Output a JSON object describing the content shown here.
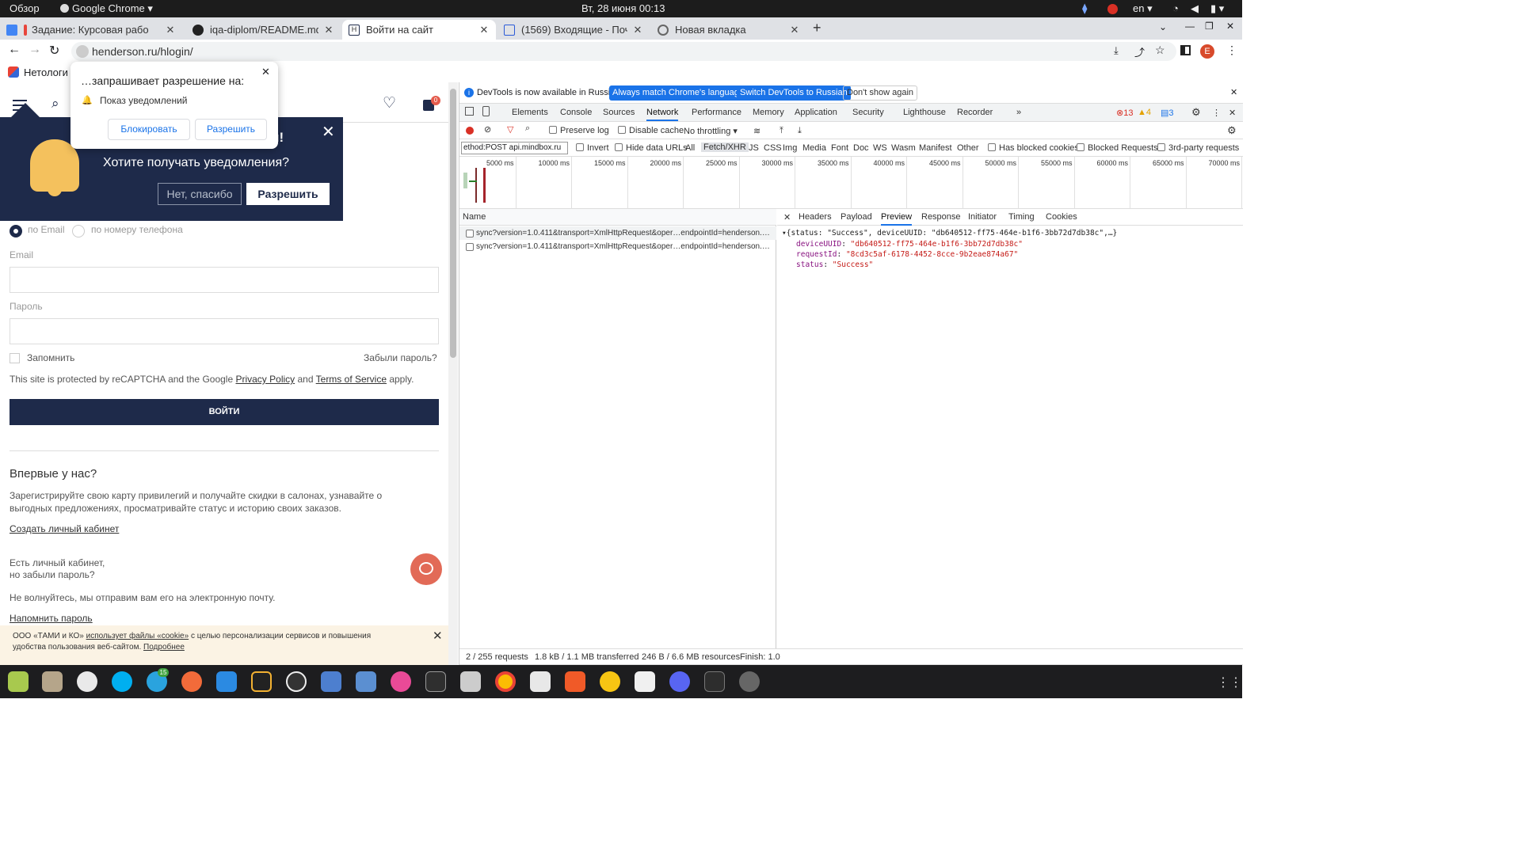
{
  "topbar": {
    "overview": "Обзор",
    "app": "Google Chrome",
    "clock": "Вт, 28 июня  00:13",
    "lang": "en",
    "notif_count": "15"
  },
  "tabs": [
    {
      "title": "Задание: Курсовая рабо"
    },
    {
      "title": "iqa-diplom/README.md"
    },
    {
      "title": "Войти на сайт"
    },
    {
      "title": "(1569) Входящие - Почта"
    },
    {
      "title": "Новая вкладка"
    }
  ],
  "omnibox": {
    "url": "henderson.ru/hlogin/"
  },
  "profile_initial": "E",
  "bookmark": {
    "label": "Нетологи"
  },
  "perm_popup": {
    "title": "…запрашивает разрешение на:",
    "item": "Показ уведомлений",
    "block": "Блокировать",
    "allow": "Разрешить"
  },
  "notif_banner": {
    "title_tail": "и!",
    "question": "Хотите получать уведомления?",
    "no": "Нет, спасибо",
    "yes": "Разрешить"
  },
  "cart_count": "0",
  "login": {
    "radio_email": "по Email",
    "radio_phone": "по номеру телефона",
    "email_label": "Email",
    "password_label": "Пароль",
    "remember": "Запомнить",
    "forgot": "Забыли пароль?",
    "captcha_1": "This site is protected by reCAPTCHA and the Google ",
    "captcha_pp": "Privacy Policy",
    "captcha_and": " and ",
    "captcha_tos": "Terms of Service",
    "captcha_end": " apply.",
    "submit": "ВОЙТИ",
    "first_heading": "Впервые у нас?",
    "first_text": "Зарегистрируйте свою карту привилегий и получайте скидки в салонах, узнавайте о выгодных предложениях, просматривайте статус и историю своих заказов.",
    "create": "Создать личный кабинет",
    "have_1": "Есть личный кабинет,",
    "have_2": "но забыли пароль?",
    "send_text": "Не волнуйтесь, мы отправим вам его на электронную почту.",
    "remind": "Напомнить пароль"
  },
  "cookie": {
    "text_a": "ООО «ТАМИ и КО» ",
    "text_link": "использует файлы «cookie»",
    "text_b": " с целью персонализации сервисов и повышения",
    "text_c": "удобства пользования веб-сайтом. ",
    "more": "Подробнее"
  },
  "devtools": {
    "info_text": "DevTools is now available in Russian!",
    "btn_match": "Always match Chrome's language",
    "btn_switch": "Switch DevTools to Russian",
    "btn_dont": "Don't show again",
    "tabs": [
      "Elements",
      "Console",
      "Sources",
      "Network",
      "Performance",
      "Memory",
      "Application",
      "Security",
      "Lighthouse",
      "Recorder"
    ],
    "errors": "13",
    "warnings": "4",
    "messages": "3",
    "preserve": "Preserve log",
    "disable_cache": "Disable cache",
    "throttling": "No throttling",
    "filter_value": "ethod:POST api.mindbox.ru",
    "invert": "Invert",
    "hide_data": "Hide data URLs",
    "types": [
      "All",
      "Fetch/XHR",
      "JS",
      "CSS",
      "Img",
      "Media",
      "Font",
      "Doc",
      "WS",
      "Wasm",
      "Manifest",
      "Other"
    ],
    "has_blocked": "Has blocked cookies",
    "blocked_req": "Blocked Requests",
    "third_party": "3rd-party requests",
    "ticks": [
      "5000 ms",
      "10000 ms",
      "15000 ms",
      "20000 ms",
      "25000 ms",
      "30000 ms",
      "35000 ms",
      "40000 ms",
      "45000 ms",
      "50000 ms",
      "55000 ms",
      "60000 ms",
      "65000 ms",
      "70000 ms"
    ],
    "name_header": "Name",
    "requests": [
      "sync?version=1.0.411&transport=XmlHttpRequest&oper…endpointId=henderson.…",
      "sync?version=1.0.411&transport=XmlHttpRequest&oper…endpointId=henderson.…"
    ],
    "detail_tabs": [
      "Headers",
      "Payload",
      "Preview",
      "Response",
      "Initiator",
      "Timing",
      "Cookies"
    ],
    "preview_summary": "{status: \"Success\", deviceUUID: \"db640512-ff75-464e-b1f6-3bb72d7db38c\",…}",
    "preview_rows": [
      {
        "key": "deviceUUID",
        "value": "\"db640512-ff75-464e-b1f6-3bb72d7db38c\""
      },
      {
        "key": "requestId",
        "value": "\"8cd3c5af-6178-4452-8cce-9b2eae874a67\""
      },
      {
        "key": "status",
        "value": "\"Success\""
      }
    ],
    "status": {
      "requests": "2 / 255 requests",
      "transferred": "1.8 kB / 1.1 MB transferred",
      "resources": "246 B / 6.6 MB resources",
      "finish": "Finish: 1.0"
    }
  },
  "taskbar": {
    "telegram_badge": "15"
  }
}
